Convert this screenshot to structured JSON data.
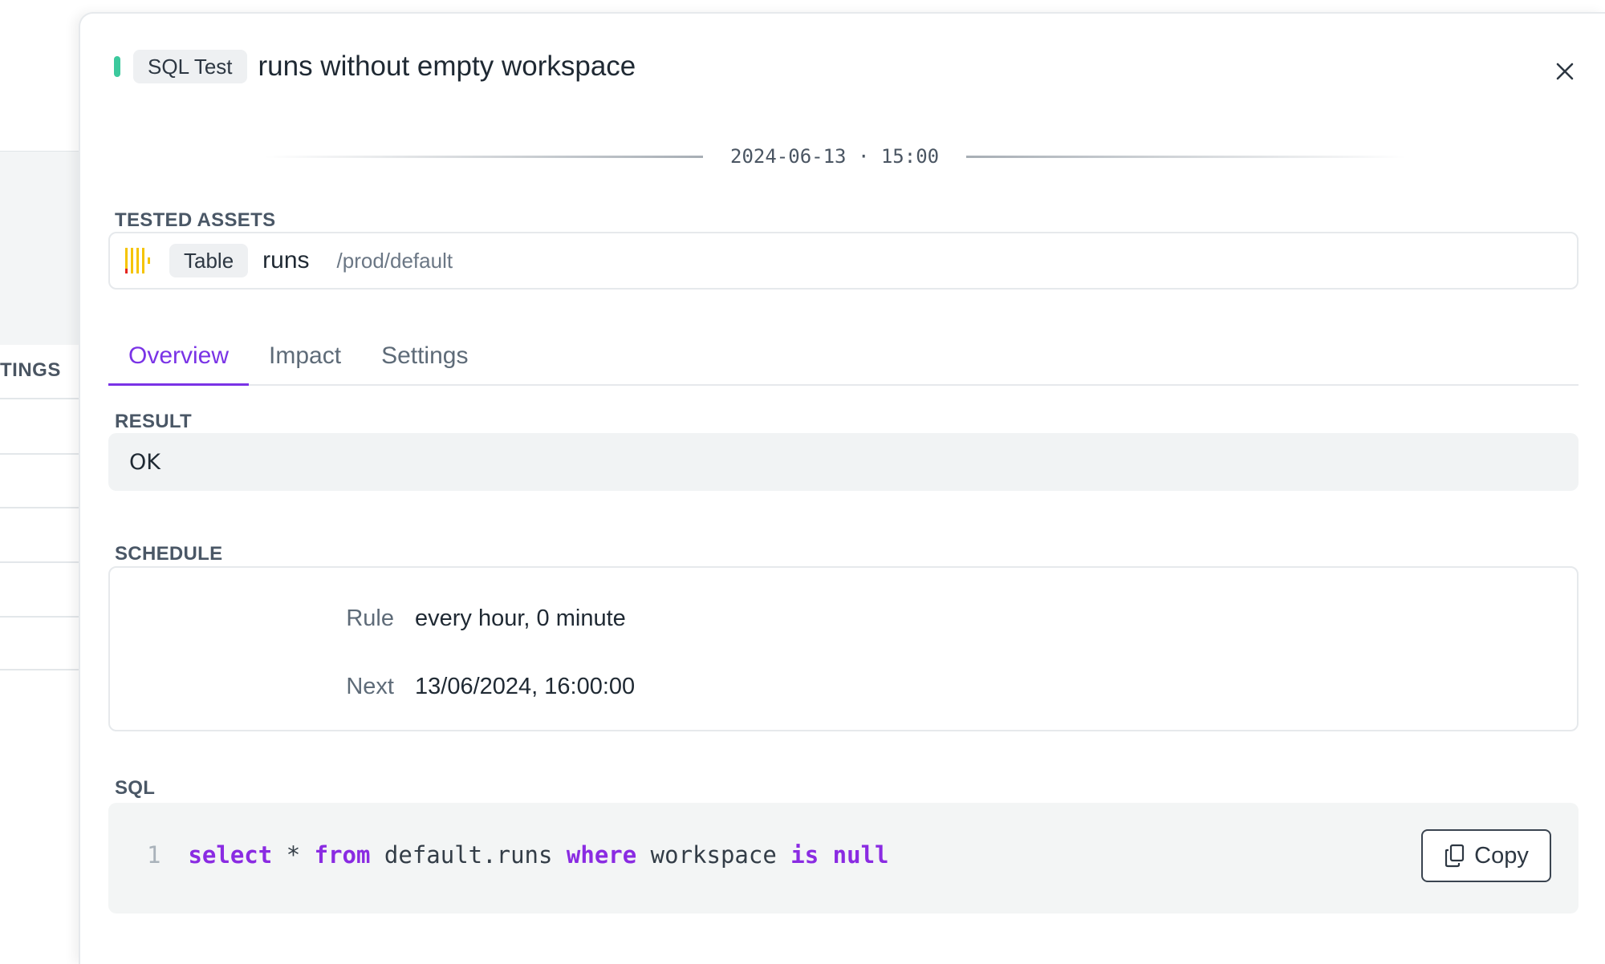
{
  "background": {
    "section_heading": "TINGS"
  },
  "drawer": {
    "type_chip": "SQL Test",
    "title": "runs without empty workspace",
    "timestamp": "2024-06-13 · 15:00",
    "status_color": "#3cc99d",
    "tested_assets": {
      "label": "TESTED ASSETS",
      "asset": {
        "icon": "clickhouse-table-icon",
        "type": "Table",
        "name": "runs",
        "path": "/prod/default"
      }
    },
    "tabs": [
      {
        "label": "Overview",
        "active": true
      },
      {
        "label": "Impact",
        "active": false
      },
      {
        "label": "Settings",
        "active": false
      }
    ],
    "accent_color": "#7a33e6",
    "result": {
      "label": "RESULT",
      "value": "OK"
    },
    "schedule": {
      "label": "SCHEDULE",
      "rule_key": "Rule",
      "rule_value": "every hour, 0 minute",
      "next_key": "Next",
      "next_value": "13/06/2024, 16:00:00"
    },
    "sql": {
      "label": "SQL",
      "line_number": "1",
      "tokens": {
        "t1": "select",
        "t2": " * ",
        "t3": "from",
        "t4": " default.runs ",
        "t5": "where",
        "t6": " workspace ",
        "t7": "is",
        "t8": " ",
        "t9": "null"
      },
      "copy_label": "Copy"
    }
  }
}
